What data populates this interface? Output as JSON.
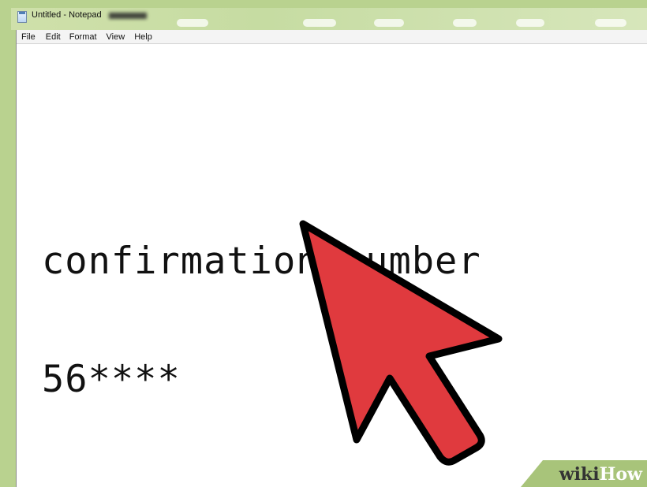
{
  "window": {
    "title": "Untitled - Notepad",
    "app_icon": "notepad-icon"
  },
  "menubar": {
    "items": [
      {
        "label": "File"
      },
      {
        "label": "Edit"
      },
      {
        "label": "Format"
      },
      {
        "label": "View"
      },
      {
        "label": "Help"
      }
    ]
  },
  "document": {
    "lines": [
      "confirmation number",
      "56****"
    ]
  },
  "overlay": {
    "icon": "pointer-arrow-icon",
    "fill_color": "#e03a3e",
    "outline_color": "#000000"
  },
  "watermark": {
    "part1": "wiki",
    "part2": "How"
  },
  "colors": {
    "desktop": "#b9d28f",
    "menubar_bg": "#f4f4f4",
    "editor_bg": "#ffffff",
    "watermark_band": "#a8c47a"
  }
}
